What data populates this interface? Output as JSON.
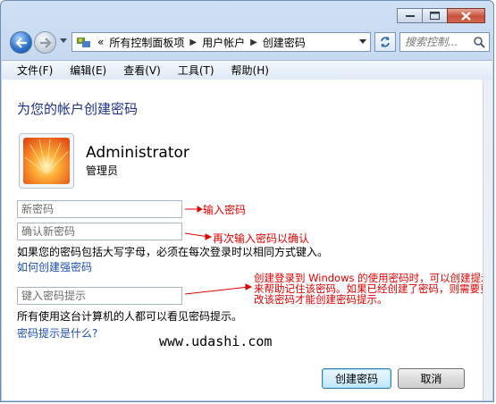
{
  "window": {
    "controls": {
      "minimize_icon": "minimize-icon",
      "maximize_icon": "maximize-icon",
      "close_icon": "close-icon"
    }
  },
  "address_bar": {
    "overflow": "«",
    "breadcrumbs": [
      "所有控制面板项",
      "用户帐户",
      "创建密码"
    ],
    "search_placeholder": "搜索控制..."
  },
  "menu": [
    "文件(F)",
    "编辑(E)",
    "查看(V)",
    "工具(T)",
    "帮助(H)"
  ],
  "page": {
    "heading": "为您的帐户创建密码",
    "user": {
      "name": "Administrator",
      "role": "管理员"
    },
    "new_password_placeholder": "新密码",
    "confirm_password_placeholder": "确认新密码",
    "caps_note": "如果您的密码包括大写字母，必须在每次登录时以相同方式键入。",
    "strong_link": "如何创建强密码",
    "hint_placeholder": "键入密码提示",
    "hint_note": "所有使用这台计算机的人都可以看见密码提示。",
    "hint_link": "密码提示是什么?",
    "create_button": "创建密码",
    "cancel_button": "取消"
  },
  "annotations": {
    "a1": "输入密码",
    "a2": "再次输入密码以确认",
    "a3": "创建登录到 Windows 的使用密码时，可以创建提示来帮助记住该密码。如果已经创建了密码，则需要更改该密码才能创建密码提示。",
    "color": "#e00000"
  },
  "watermark": "www.udashi.com"
}
